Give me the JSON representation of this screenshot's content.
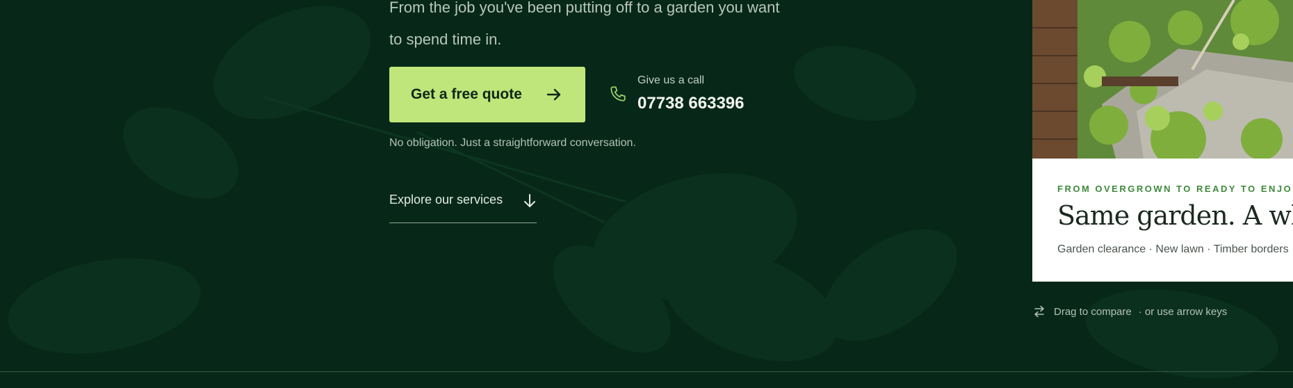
{
  "hero": {
    "subtitle_line1": "From the job you've been putting off to a garden you want",
    "subtitle_line2": "to spend time in."
  },
  "cta": {
    "quote_label": "Get a free quote",
    "call_label": "Give us a call",
    "phone": "07738 663396",
    "note": "No obligation. Just a straightforward conversation."
  },
  "explore": {
    "label": "Explore our services"
  },
  "compare": {
    "eyebrow": "FROM OVERGROWN TO READY TO ENJOY",
    "title": "Same garden. A whole",
    "services": "Garden clearance · New lawn · Timber borders",
    "drag_label": "Drag to compare",
    "drag_extra": "· or use arrow keys"
  },
  "colors": {
    "background": "#072818",
    "accent": "#bfe67a",
    "eyebrow": "#3d8a3a"
  },
  "icons": [
    "arrow-right-icon",
    "phone-icon",
    "arrow-down-icon",
    "swap-arrows-icon"
  ]
}
